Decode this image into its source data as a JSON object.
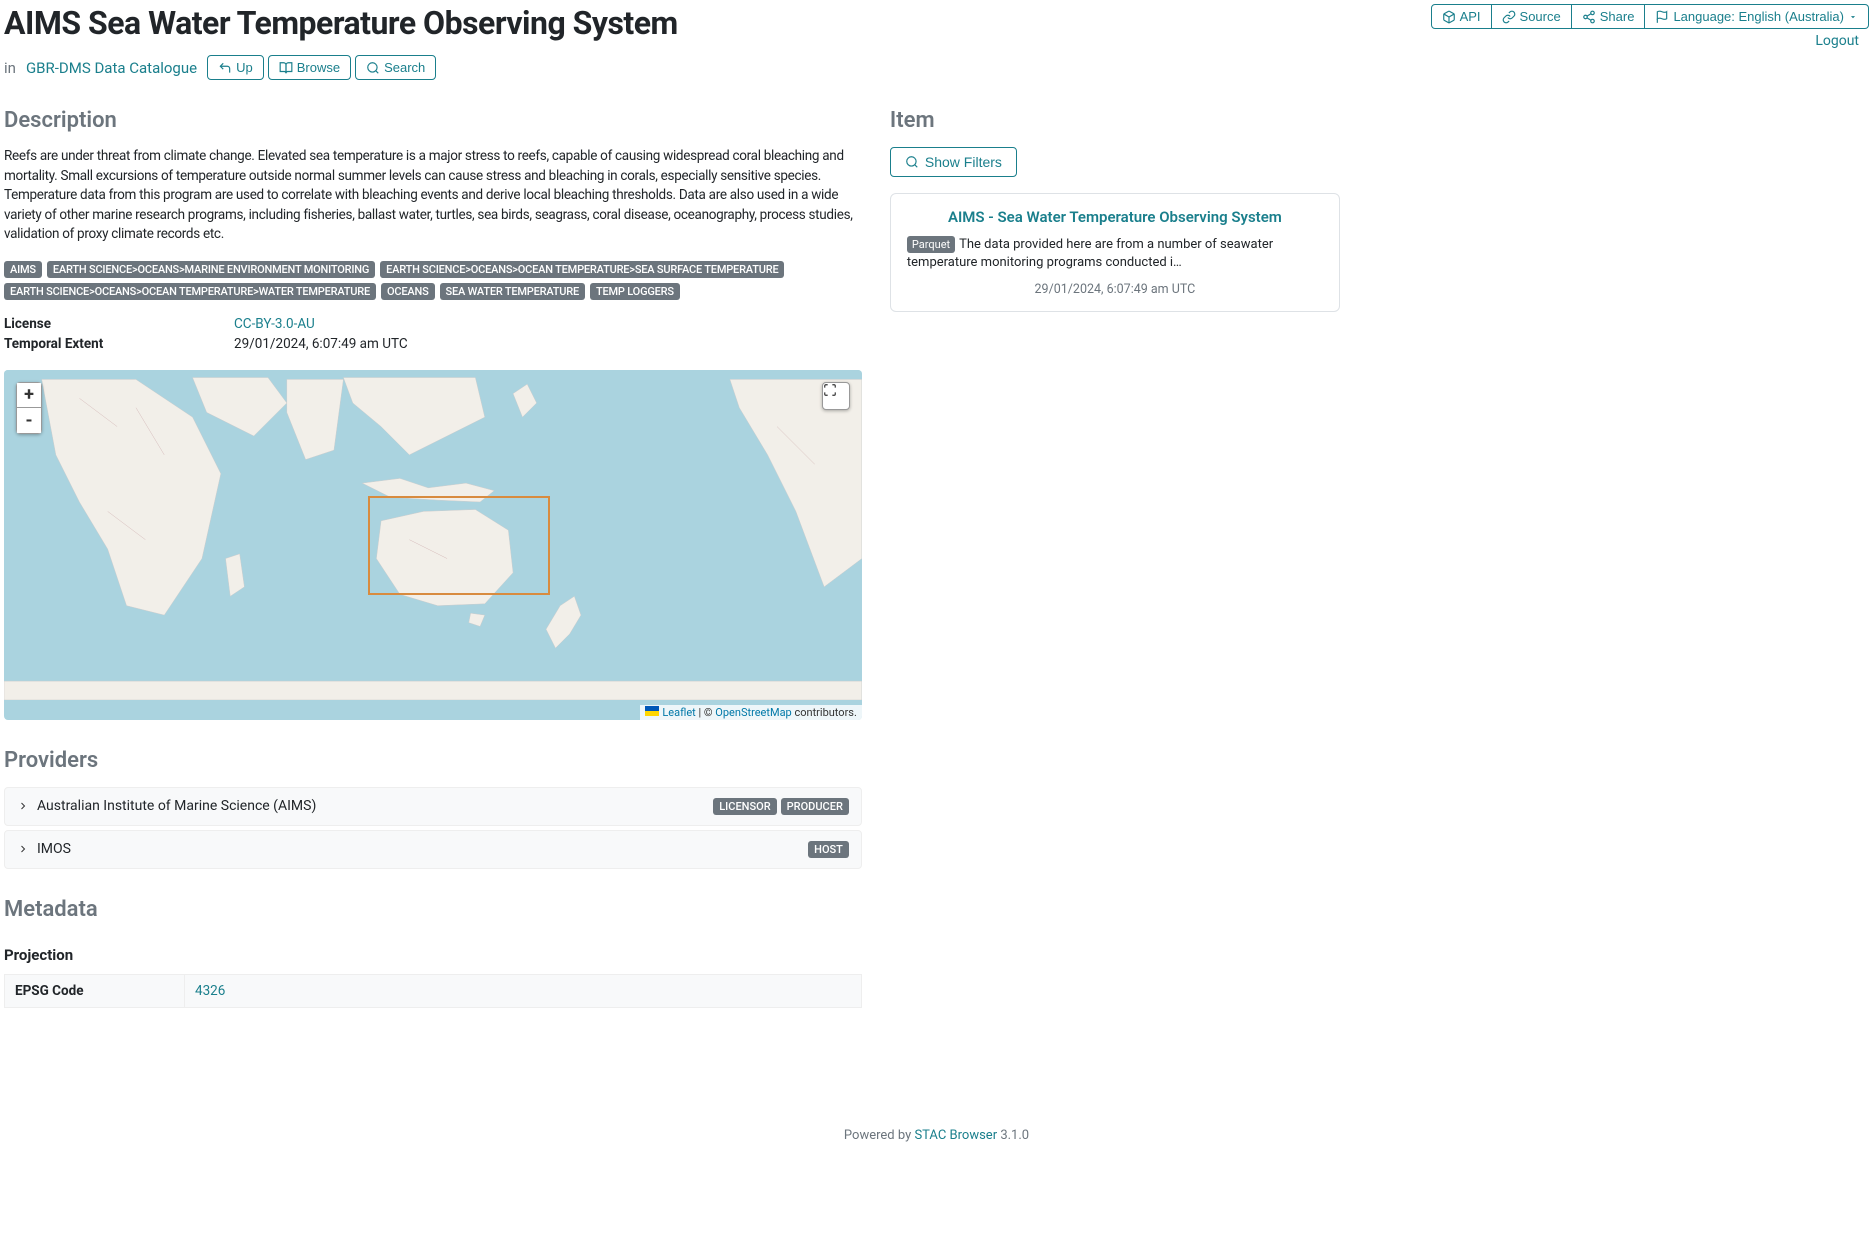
{
  "title": "AIMS Sea Water Temperature Observing System",
  "breadcrumb": {
    "in": "in",
    "catalogue": "GBR-DMS Data Catalogue"
  },
  "nav": {
    "up": "Up",
    "browse": "Browse",
    "search": "Search"
  },
  "topbar": {
    "api": "API",
    "source": "Source",
    "share": "Share",
    "language": "Language: English (Australia)"
  },
  "logout": "Logout",
  "sections": {
    "description": "Description",
    "item": "Item",
    "providers": "Providers",
    "metadata": "Metadata",
    "projection": "Projection"
  },
  "description_text": "Reefs are under threat from climate change. Elevated sea temperature is a major stress to reefs, capable of causing widespread coral bleaching and mortality. Small excursions of temperature outside normal summer levels can cause stress and bleaching in corals, especially sensitive species. Temperature data from this program are used to correlate with bleaching events and derive local bleaching thresholds. Data are also used in a wide variety of other marine research programs, including fisheries, ballast water, turtles, sea birds, seagrass, coral disease, oceanography, process studies, validation of proxy climate records etc.",
  "tags": [
    "AIMS",
    "EARTH SCIENCE>OCEANS>MARINE ENVIRONMENT MONITORING",
    "EARTH SCIENCE>OCEANS>OCEAN TEMPERATURE>SEA SURFACE TEMPERATURE",
    "EARTH SCIENCE>OCEANS>OCEAN TEMPERATURE>WATER TEMPERATURE",
    "Oceans",
    "Sea Water Temperature",
    "Temp Loggers"
  ],
  "license": {
    "label": "License",
    "value": "CC-BY-3.0-AU"
  },
  "temporal": {
    "label": "Temporal Extent",
    "value": "29/01/2024, 6:07:49 am UTC"
  },
  "map": {
    "zoom_in": "+",
    "zoom_out": "-",
    "leaflet": "Leaflet",
    "sep": " | © ",
    "osm": "OpenStreetMap",
    "contrib": " contributors."
  },
  "providers": [
    {
      "name": "Australian Institute of Marine Science (AIMS)",
      "badges": [
        "LICENSOR",
        "PRODUCER"
      ]
    },
    {
      "name": "IMOS",
      "badges": [
        "HOST"
      ]
    }
  ],
  "metadata": {
    "epsg_label": "EPSG Code",
    "epsg_value": "4326"
  },
  "filters_btn": "Show Filters",
  "item_card": {
    "title": "AIMS - Sea Water Temperature Observing System",
    "badge": "Parquet",
    "body": "The data provided here are from a number of seawater temperature monitoring programs conducted i…",
    "date": "29/01/2024, 6:07:49 am UTC"
  },
  "footer": {
    "powered": "Powered by ",
    "name": "STAC Browser",
    "version": " 3.1.0"
  }
}
